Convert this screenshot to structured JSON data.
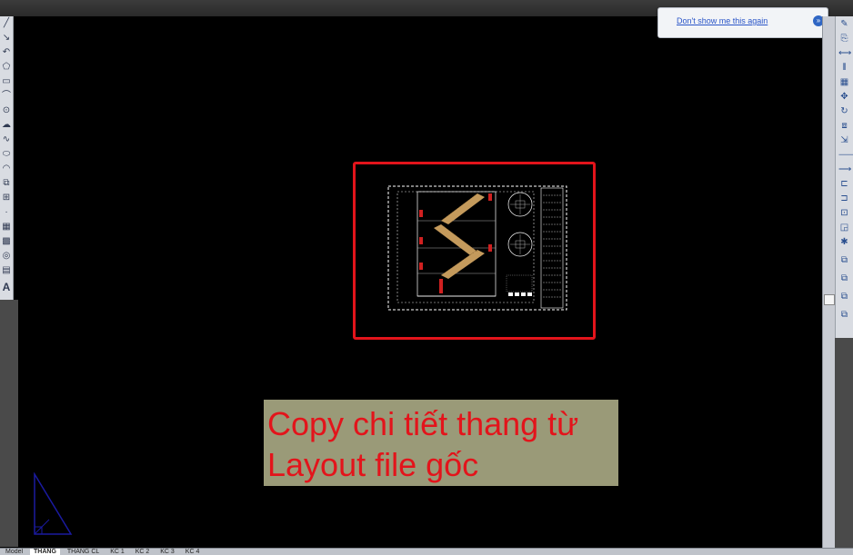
{
  "notification": {
    "link_text": "Don't show me this again"
  },
  "caption": {
    "line1": "Copy chi tiết thang từ",
    "line2": "Layout file gốc"
  },
  "toolbar_left": {
    "items": [
      "line-icon",
      "polyline-icon",
      "polygon-icon",
      "rectangle-icon",
      "arc-icon",
      "circle-icon",
      "revision-cloud-icon",
      "spline-icon",
      "ellipse-icon",
      "ellipse-arc-icon",
      "insert-block-icon",
      "make-block-icon",
      "point-icon",
      "hatch-icon",
      "gradient-icon",
      "region-icon",
      "table-icon",
      "multiline-text-icon"
    ]
  },
  "toolbar_right": {
    "items": [
      "erase-icon",
      "copy-icon",
      "mirror-icon",
      "offset-icon",
      "array-icon",
      "move-icon",
      "rotate-icon",
      "scale-icon",
      "stretch-icon",
      "trim-icon",
      "extend-icon",
      "break-icon",
      "join-icon",
      "chamfer-icon",
      "fillet-icon",
      "explode-icon",
      "draworder-front-icon",
      "draworder-back-icon",
      "draworder-above-icon",
      "draworder-under-icon"
    ]
  },
  "bottom_tabs": [
    "Model",
    "THANG",
    "THANG CL",
    "KC 1",
    "KC 2",
    "KC 3",
    "KC 4"
  ],
  "colors": {
    "highlight": "#e3141b",
    "caption_bg": "#9a9a78",
    "caption_text": "#e3141b",
    "stair_fill": "#c49a5c"
  }
}
